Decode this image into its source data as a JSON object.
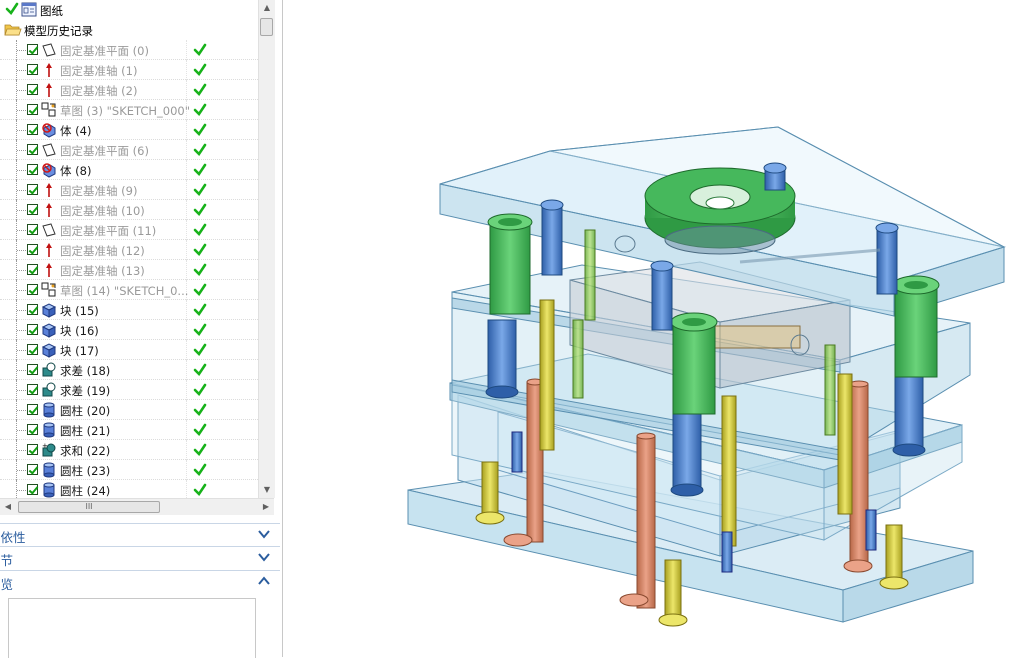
{
  "navigator": {
    "drawing_label": "图纸",
    "history_label": "模型历史记录",
    "features": [
      {
        "label": "固定基准平面 (0)",
        "icon": "datum-plane-icon",
        "dim": true
      },
      {
        "label": "固定基准轴 (1)",
        "icon": "datum-axis-icon",
        "dim": true
      },
      {
        "label": "固定基准轴 (2)",
        "icon": "datum-axis-icon",
        "dim": true
      },
      {
        "label": "草图 (3) \"SKETCH_000\"",
        "icon": "sketch-icon",
        "dim": true
      },
      {
        "label": "体 (4)",
        "icon": "body-icon",
        "dim": false
      },
      {
        "label": "固定基准平面 (6)",
        "icon": "datum-plane-icon",
        "dim": true
      },
      {
        "label": "体 (8)",
        "icon": "body-icon",
        "dim": false
      },
      {
        "label": "固定基准轴 (9)",
        "icon": "datum-axis-icon",
        "dim": true
      },
      {
        "label": "固定基准轴 (10)",
        "icon": "datum-axis-icon",
        "dim": true
      },
      {
        "label": "固定基准平面 (11)",
        "icon": "datum-plane-icon",
        "dim": true
      },
      {
        "label": "固定基准轴 (12)",
        "icon": "datum-axis-icon",
        "dim": true
      },
      {
        "label": "固定基准轴 (13)",
        "icon": "datum-axis-icon",
        "dim": true
      },
      {
        "label": "草图 (14) \"SKETCH_0...",
        "icon": "sketch-icon",
        "dim": true
      },
      {
        "label": "块 (15)",
        "icon": "block-icon",
        "dim": false
      },
      {
        "label": "块 (16)",
        "icon": "block-icon",
        "dim": false
      },
      {
        "label": "块 (17)",
        "icon": "block-icon",
        "dim": false
      },
      {
        "label": "求差 (18)",
        "icon": "subtract-icon",
        "dim": false
      },
      {
        "label": "求差 (19)",
        "icon": "subtract-icon",
        "dim": false
      },
      {
        "label": "圆柱 (20)",
        "icon": "cylinder-icon",
        "dim": false
      },
      {
        "label": "圆柱 (21)",
        "icon": "cylinder-icon",
        "dim": false
      },
      {
        "label": "求和 (22)",
        "icon": "unite-icon",
        "dim": false
      },
      {
        "label": "圆柱 (23)",
        "icon": "cylinder-icon",
        "dim": false
      },
      {
        "label": "圆柱 (24)",
        "icon": "cylinder-icon",
        "dim": false
      }
    ],
    "hscroll_grip": "III",
    "sections": [
      {
        "label": "相依性",
        "state": "collapsed"
      },
      {
        "label": "细节",
        "state": "collapsed"
      },
      {
        "label": "预览",
        "state": "expanded"
      }
    ]
  },
  "colors": {
    "section_title": "#2b5d9e",
    "status_ok": "#17b21a",
    "plate_fill": "#cfe8f4",
    "plate_edge": "#5a8fb0",
    "flange_green": "#35b552",
    "bushing_blue": "#3a8ee0",
    "pin_orange": "#d98060",
    "pin_yellow": "#d8d02a"
  }
}
